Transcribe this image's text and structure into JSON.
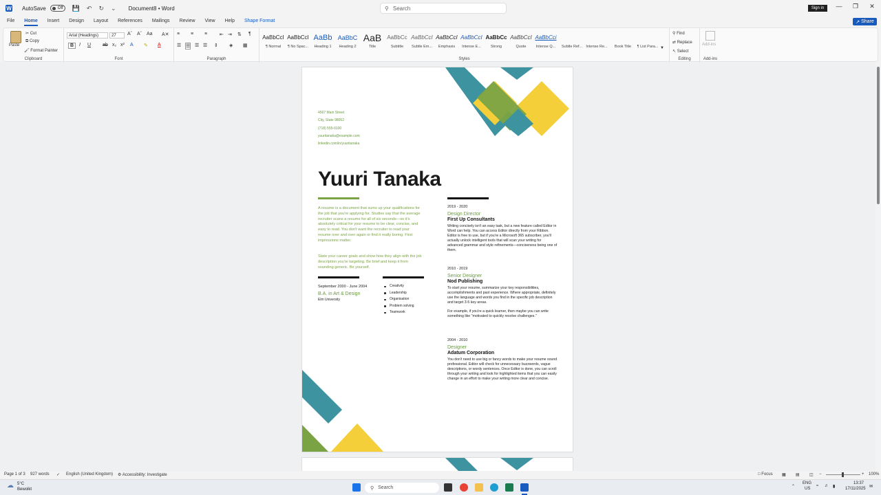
{
  "titlebar": {
    "autosave_label": "AutoSave",
    "autosave_state": "Off",
    "doc_title": "Document8 • Word",
    "search_placeholder": "Search",
    "signin": "Sign in"
  },
  "menu": {
    "tabs": [
      "File",
      "Home",
      "Insert",
      "Design",
      "Layout",
      "References",
      "Mailings",
      "Review",
      "View",
      "Help",
      "Shape Format"
    ],
    "share": "Share"
  },
  "ribbon": {
    "clipboard": {
      "paste": "Paste",
      "cut": "Cut",
      "copy": "Copy",
      "format_painter": "Format Painter",
      "label": "Clipboard"
    },
    "font": {
      "font_name": "Arial (Headings)",
      "font_size": "27",
      "label": "Font"
    },
    "paragraph": {
      "label": "Paragraph"
    },
    "styles": {
      "label": "Styles",
      "items": [
        {
          "sample": "AaBbCcI",
          "name": "¶ Normal"
        },
        {
          "sample": "AaBbCcI",
          "name": "¶ No Spac..."
        },
        {
          "sample": "AaBb",
          "name": "Heading 1"
        },
        {
          "sample": "AaBbC",
          "name": "Heading 2"
        },
        {
          "sample": "AaB",
          "name": "Title"
        },
        {
          "sample": "AaBbCc",
          "name": "Subtitle"
        },
        {
          "sample": "AaBbCcI",
          "name": "Subtle Em..."
        },
        {
          "sample": "AaBbCcI",
          "name": "Emphasis"
        },
        {
          "sample": "AaBbCcI",
          "name": "Intense E..."
        },
        {
          "sample": "AaBbCc",
          "name": "Strong"
        },
        {
          "sample": "AaBbCcI",
          "name": "Quote"
        },
        {
          "sample": "AaBbCci",
          "name": "Intense Q..."
        },
        {
          "sample": "",
          "name": "Subtle Ref..."
        },
        {
          "sample": "",
          "name": "Intense Re..."
        },
        {
          "sample": "",
          "name": "Book Title"
        },
        {
          "sample": "",
          "name": "¶ List Para..."
        }
      ]
    },
    "editing": {
      "find": "Find",
      "replace": "Replace",
      "select": "Select",
      "label": "Editing"
    },
    "addins": {
      "addin": "Add-ins",
      "label": "Add-ins"
    }
  },
  "resume": {
    "contact": [
      "4567 Main Street",
      "City, State 98052",
      "(718) 555-0100",
      "yuuritanaka@example.com",
      "linkedin.com/in/yuuritanaka"
    ],
    "name": "Yuuri Tanaka",
    "summary_1": "A resume is a document that sums up your qualifications for the job that you're applying for. Studies say that the average recruiter scans a resume for all of six seconds—so it's absolutely critical for your resume to be clear, concise, and easy to read. You don't want the recruiter to read your resume over and over again or find it really boring. First impressions matter.",
    "summary_2": "State your career goals and show how they align with the job description you're targeting. Be brief and keep it from sounding generic. Be yourself.",
    "education": {
      "dates": "September 2000 - June 2004",
      "degree": "B.A. in Art & Design",
      "school": "Elm University"
    },
    "skills": [
      "Creativity",
      "Leadership",
      "Organisation",
      "Problem solving",
      "Teamwork"
    ],
    "jobs": [
      {
        "dates": "2019 - 2020",
        "title": "Design Director",
        "company": "First Up Consultants",
        "desc": "Writing concisely isn't an easy task, but a new feature called Editor in Word can help. You can access Editor directly from your Ribbon. Editor is free to use, but if you're a Microsoft 365 subscriber, you'll actually unlock intelligent tools that will scan your writing for advanced grammar and style refinements—conciseness being one of them.",
        "desc2": ""
      },
      {
        "dates": "2010 - 2019",
        "title": "Senior Designer",
        "company": "Nod Publishing",
        "desc": "To start your resume, summarize your key responsibilities, accomplishments and past experience. Where appropriate, definitely use the language and words you find in the specific job description and target 3-5 key areas.",
        "desc2": "For example, if you're a quick learner, then maybe you can write something like \"motivated to quickly resolve challenges.\""
      },
      {
        "dates": "2004 - 2010",
        "title": "Designer",
        "company": "Adatum Corporation",
        "desc": "You don't need to use big or fancy words to make your resume sound professional. Editor will check for unnecessary buzzwords, vague descriptions, or wordy sentences. Once Editor is done, you can scroll through your writing and look for highlighted items that you can easily change in an effort to make your writing more clear and concise.",
        "desc2": ""
      }
    ]
  },
  "statusbar": {
    "page": "Page 1 of 3",
    "words": "927 words",
    "language": "English (United Kingdom)",
    "accessibility": "Accessibility: Investigate",
    "focus": "Focus",
    "zoom": "100%"
  },
  "taskbar": {
    "weather_temp": "5°C",
    "weather_desc": "Bewolkt",
    "search": "Search",
    "lang": "ENG",
    "region": "US",
    "time": "13:37",
    "date": "17/11/2025"
  },
  "colors": {
    "teal": "#3d94a0",
    "green": "#7aa343",
    "yellow": "#f5cf3a",
    "accent": "#185abd"
  }
}
